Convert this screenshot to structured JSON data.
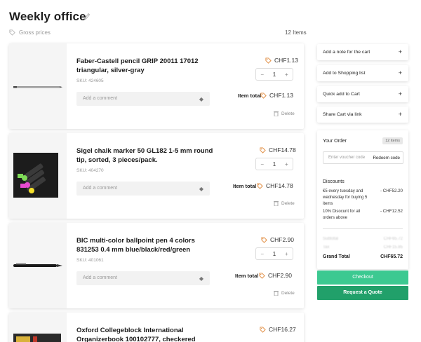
{
  "header": {
    "title": "Weekly office",
    "gross_prices": "Gross prices",
    "items_count": "12 Items"
  },
  "products": [
    {
      "name": "Faber-Castell pencil GRIP 20011 17012 triangular, silver-gray",
      "sku": "SKU: 424605",
      "price": "CHF1.13",
      "quantity": "1",
      "item_total_label": "Item total",
      "item_total": "CHF1.13",
      "comment_placeholder": "Add a comment",
      "delete_label": "Delete"
    },
    {
      "name": "Sigel chalk marker 50 GL182 1-5 mm round tip, sorted, 3 pieces/pack.",
      "sku": "SKU: 404270",
      "price": "CHF14.78",
      "quantity": "1",
      "item_total_label": "Item total",
      "item_total": "CHF14.78",
      "comment_placeholder": "Add a comment",
      "delete_label": "Delete"
    },
    {
      "name": "BIC multi-color ballpoint pen 4 colors 831253 0.4 mm blue/black/red/green",
      "sku": "SKU: 401061",
      "price": "CHF2.90",
      "quantity": "1",
      "item_total_label": "Item total",
      "item_total": "CHF2.90",
      "comment_placeholder": "Add a comment",
      "delete_label": "Delete"
    },
    {
      "name": "Oxford Collegeblock International Organizerbook 100102777, checkered",
      "price": "CHF16.27"
    }
  ],
  "sidebar": {
    "actions": [
      "Add a note for the cart",
      "Add to Shopping list",
      "Quick add to Cart",
      "Share Cart via link"
    ],
    "order": {
      "title": "Your Order",
      "badge": "12 items",
      "voucher_placeholder": "Enter voucher code",
      "redeem_label": "Redeem code",
      "discounts_title": "Discounts",
      "discounts": [
        {
          "text": "€5 every tuesday and wednesday for buying 5 items",
          "value": "- CHF52.20"
        },
        {
          "text": "10% Disocunt for all orders above",
          "value": "- CHF12.52"
        }
      ],
      "subtotal_rows": [
        {
          "label": "Subtotal",
          "value": "CHF65.72"
        },
        {
          "label": "Tax",
          "value": "CHF15.85"
        }
      ],
      "grand_total_label": "Grand Total",
      "grand_total": "CHF65.72"
    },
    "checkout_label": "Checkout",
    "quote_label": "Request a Quote"
  },
  "colors": {
    "checkout": "#3cc991",
    "quote": "#21a06a",
    "tag_icon": "#e08a3c"
  }
}
